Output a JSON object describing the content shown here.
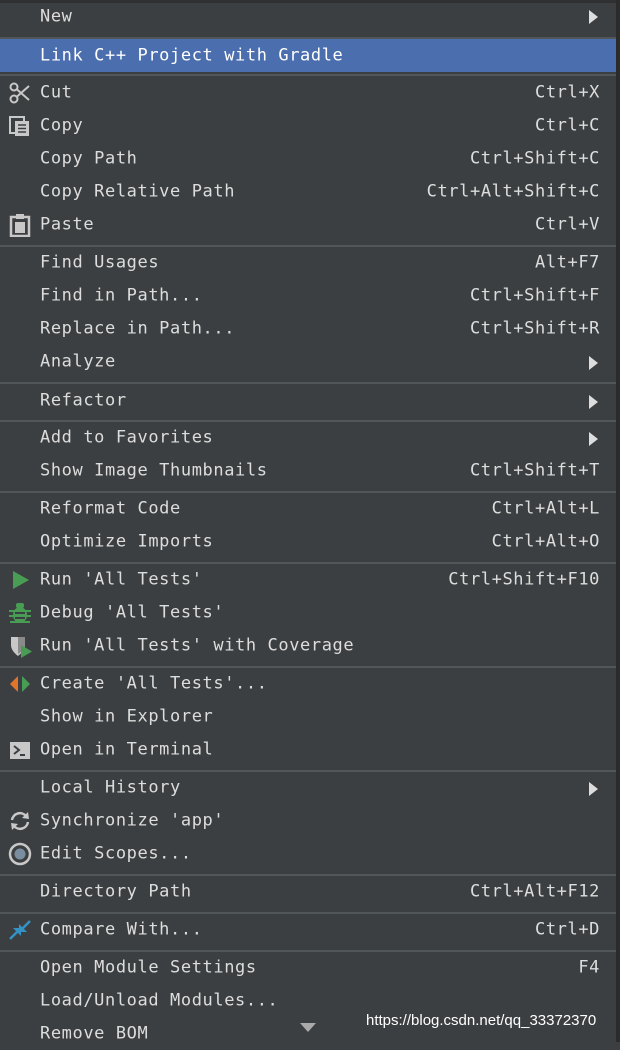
{
  "menu": {
    "items": [
      {
        "label": "New",
        "shortcut": "",
        "submenu": true,
        "icon": ""
      },
      {
        "label": "Link C++ Project with Gradle",
        "shortcut": "",
        "submenu": false,
        "icon": "",
        "highlighted": true
      },
      {
        "label": "Cut",
        "shortcut": "Ctrl+X",
        "icon": "scissors-icon"
      },
      {
        "label": "Copy",
        "shortcut": "Ctrl+C",
        "icon": "copy-icon"
      },
      {
        "label": "Copy Path",
        "shortcut": "Ctrl+Shift+C",
        "icon": ""
      },
      {
        "label": "Copy Relative Path",
        "shortcut": "Ctrl+Alt+Shift+C",
        "icon": ""
      },
      {
        "label": "Paste",
        "shortcut": "Ctrl+V",
        "icon": "clipboard-icon"
      },
      {
        "label": "Find Usages",
        "shortcut": "Alt+F7",
        "icon": ""
      },
      {
        "label": "Find in Path...",
        "shortcut": "Ctrl+Shift+F",
        "icon": ""
      },
      {
        "label": "Replace in Path...",
        "shortcut": "Ctrl+Shift+R",
        "icon": ""
      },
      {
        "label": "Analyze",
        "shortcut": "",
        "submenu": true,
        "icon": ""
      },
      {
        "label": "Refactor",
        "shortcut": "",
        "submenu": true,
        "icon": ""
      },
      {
        "label": "Add to Favorites",
        "shortcut": "",
        "submenu": true,
        "icon": ""
      },
      {
        "label": "Show Image Thumbnails",
        "shortcut": "Ctrl+Shift+T",
        "icon": ""
      },
      {
        "label": "Reformat Code",
        "shortcut": "Ctrl+Alt+L",
        "icon": ""
      },
      {
        "label": "Optimize Imports",
        "shortcut": "Ctrl+Alt+O",
        "icon": ""
      },
      {
        "label": "Run 'All Tests'",
        "shortcut": "Ctrl+Shift+F10",
        "icon": "run-icon"
      },
      {
        "label": "Debug 'All Tests'",
        "shortcut": "",
        "icon": "debug-bug-icon"
      },
      {
        "label": "Run 'All Tests' with Coverage",
        "shortcut": "",
        "icon": "coverage-icon"
      },
      {
        "label": "Create 'All Tests'...",
        "shortcut": "",
        "icon": "create-config-icon"
      },
      {
        "label": "Show in Explorer",
        "shortcut": "",
        "icon": ""
      },
      {
        "label": "Open in Terminal",
        "shortcut": "",
        "icon": "terminal-icon"
      },
      {
        "label": "Local History",
        "shortcut": "",
        "submenu": true,
        "icon": ""
      },
      {
        "label": "Synchronize 'app'",
        "shortcut": "",
        "icon": "sync-icon"
      },
      {
        "label": "Edit Scopes...",
        "shortcut": "",
        "icon": "scopes-icon"
      },
      {
        "label": "Directory Path",
        "shortcut": "Ctrl+Alt+F12",
        "icon": ""
      },
      {
        "label": "Compare With...",
        "shortcut": "Ctrl+D",
        "icon": "compare-icon"
      },
      {
        "label": "Open Module Settings",
        "shortcut": "F4",
        "icon": ""
      },
      {
        "label": "Load/Unload Modules...",
        "shortcut": "",
        "icon": ""
      },
      {
        "label": "Remove BOM",
        "shortcut": "",
        "icon": ""
      }
    ]
  },
  "watermark": "https://blog.csdn.net/qq_33372370",
  "colors": {
    "background": "#3c3f41",
    "highlight": "#4b6eaf",
    "text": "#dddddd",
    "separator": "#515658",
    "run_green": "#499c54",
    "coverage_blue": "#3592c4"
  }
}
